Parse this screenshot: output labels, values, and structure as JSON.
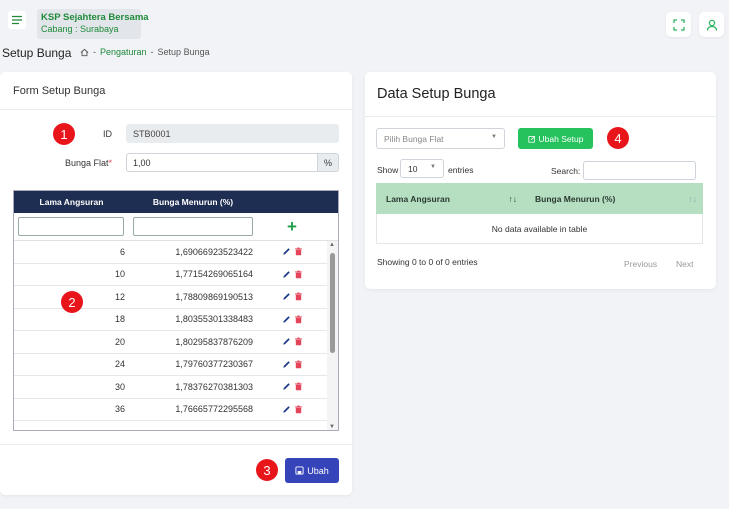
{
  "header": {
    "brand_name": "KSP Sejahtera Bersama",
    "branch": "Cabang : Surabaya",
    "icons": [
      "menu-icon",
      "fullscreen-icon",
      "user-icon"
    ]
  },
  "page": {
    "title": "Setup Bunga",
    "breadcrumb": [
      "Pengaturan",
      "-",
      "Setup Bunga"
    ],
    "breadcrumb_sep": "-"
  },
  "form": {
    "title": "Form Setup Bunga",
    "id_label": "ID",
    "id_value": "STB0001",
    "flat_label": "Bunga Flat",
    "flat_required": "*",
    "flat_value": "1,00",
    "flat_suffix": "%",
    "table": {
      "col1": "Lama Angsuran",
      "col2": "Bunga Menurun (%)",
      "add_glyph": "+",
      "rows": [
        {
          "lama": "6",
          "bunga": "1,69066923523422"
        },
        {
          "lama": "10",
          "bunga": "1,77154269065164"
        },
        {
          "lama": "12",
          "bunga": "1,78809869190513"
        },
        {
          "lama": "18",
          "bunga": "1,80355301338483"
        },
        {
          "lama": "20",
          "bunga": "1,80295837876209"
        },
        {
          "lama": "24",
          "bunga": "1,79760377230367"
        },
        {
          "lama": "30",
          "bunga": "1,78376270381303"
        },
        {
          "lama": "36",
          "bunga": "1,76665772295568"
        }
      ]
    },
    "submit_label": "Ubah"
  },
  "datatable": {
    "title": "Data Setup Bunga",
    "select_placeholder": "Pilih Bunga Flat",
    "ubah_setup_label": "Ubah Setup",
    "show_label": "Show",
    "entries_value": "10",
    "entries_label": "entries",
    "search_label": "Search:",
    "col1": "Lama Angsuran",
    "col2": "Bunga Menurun (%)",
    "empty": "No data available in table",
    "info": "Showing 0 to 0 of 0 entries",
    "prev": "Previous",
    "next": "Next"
  },
  "badges": [
    "1",
    "2",
    "3",
    "4"
  ],
  "colors": {
    "accent_green": "#25c25d",
    "primary_blue": "#3544b8",
    "table_head": "#1e2d52",
    "badge_red": "#e8151b"
  }
}
